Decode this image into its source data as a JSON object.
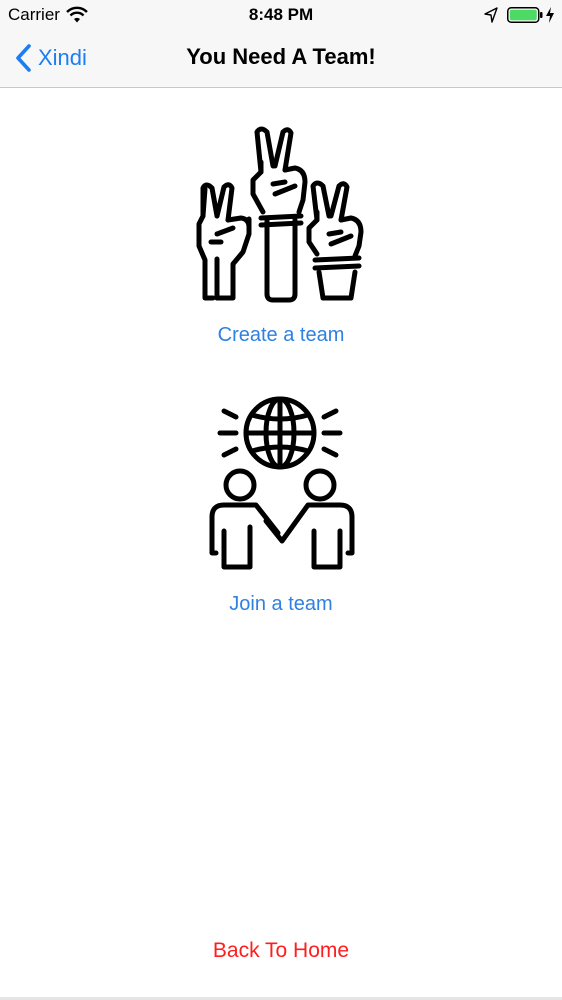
{
  "status_bar": {
    "carrier": "Carrier",
    "time": "8:48 PM",
    "battery_level": 1.0,
    "icons": [
      "wifi-icon",
      "location-arrow-icon",
      "battery-icon",
      "charging-bolt-icon"
    ]
  },
  "nav_bar": {
    "back_label": "Xindi",
    "title": "You Need A Team!"
  },
  "actions": {
    "create": {
      "icon": "raised-hands-peace-icon",
      "label": "Create a team"
    },
    "join": {
      "icon": "people-globe-icon",
      "label": "Join a team"
    }
  },
  "footer": {
    "home_label": "Back To Home"
  },
  "colors": {
    "link_blue": "#2f80e0",
    "nav_blue": "#1c7ef2",
    "home_red": "#ff1d1d",
    "bar_background": "#f7f7f7",
    "battery_green": "#4cd964"
  }
}
